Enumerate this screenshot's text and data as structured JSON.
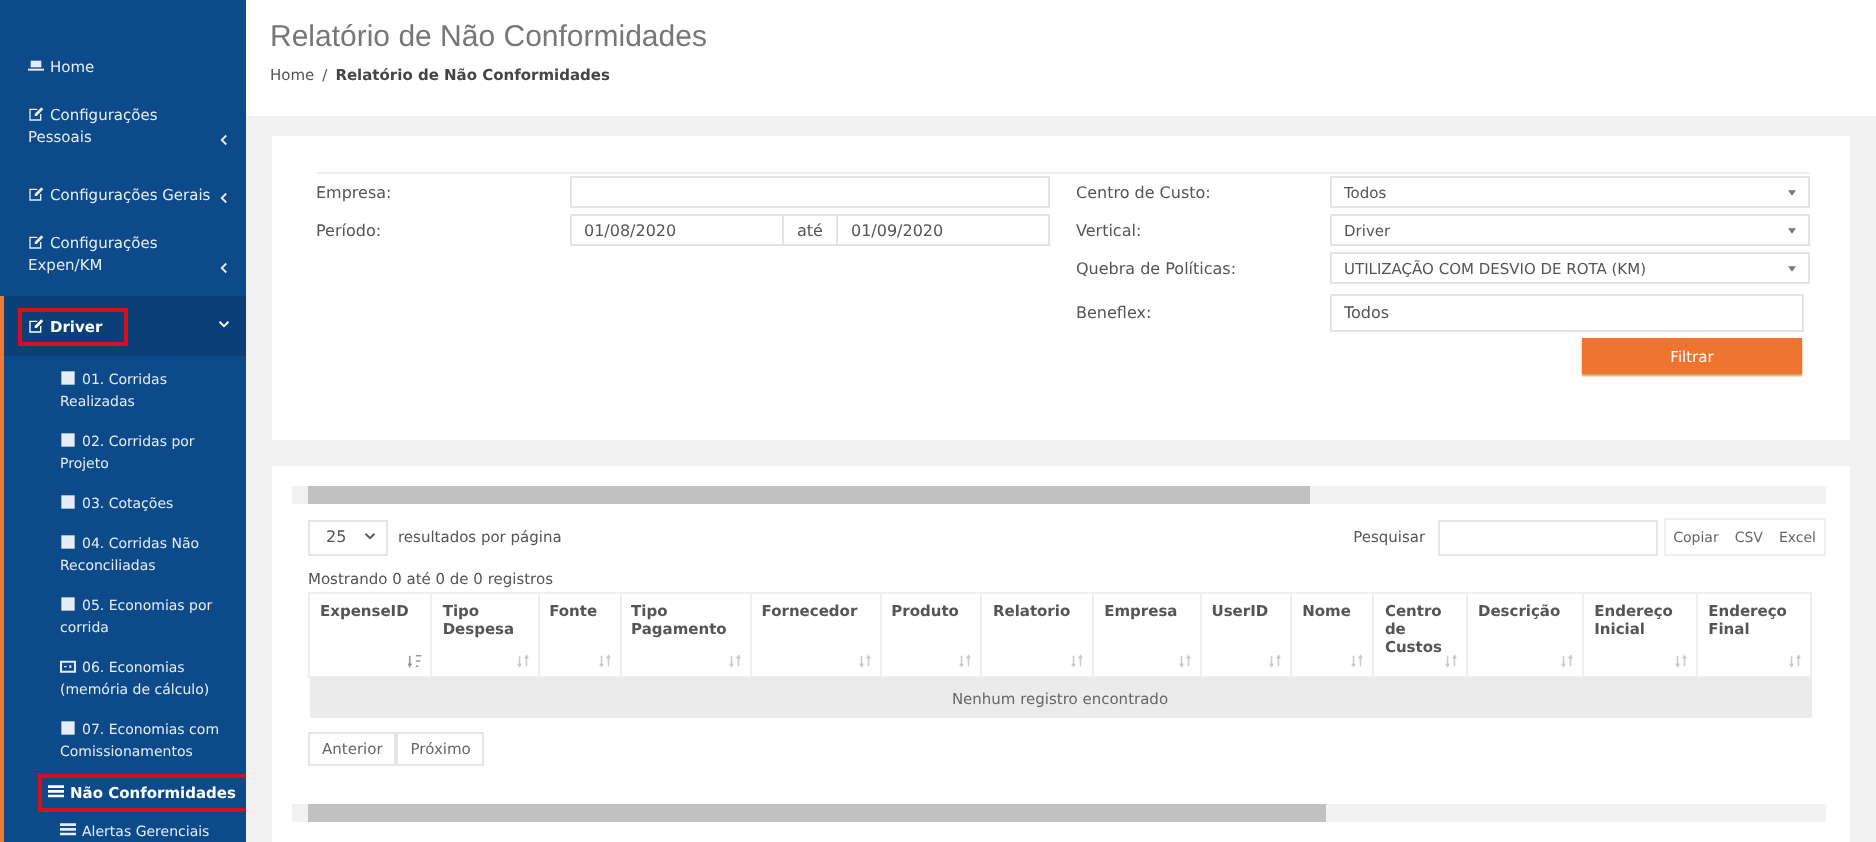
{
  "sidebar": {
    "items": [
      {
        "label": "Home",
        "kind": "home",
        "expanded": false,
        "highlighted": false
      },
      {
        "label": "Configurações Pessoais",
        "kind": "section",
        "expanded": false,
        "highlighted": false,
        "has_caret": true
      },
      {
        "label": "Configurações Gerais",
        "kind": "section",
        "expanded": false,
        "highlighted": false,
        "has_caret": true
      },
      {
        "label": "Configurações Expen/KM",
        "kind": "section",
        "expanded": false,
        "highlighted": false,
        "has_caret": true
      },
      {
        "label": "Driver",
        "kind": "section",
        "expanded": true,
        "highlighted": true,
        "has_caret": true,
        "children": [
          {
            "label": "01. Corridas Realizadas",
            "kind": "page",
            "selected": false,
            "highlighted": false
          },
          {
            "label": "02. Corridas por Projeto",
            "kind": "page",
            "selected": false,
            "highlighted": false
          },
          {
            "label": "03. Cotações",
            "kind": "page",
            "selected": false,
            "highlighted": false
          },
          {
            "label": "04. Corridas Não Reconciliadas",
            "kind": "page",
            "selected": false,
            "highlighted": false
          },
          {
            "label": "05. Economias por corrida",
            "kind": "page",
            "selected": false,
            "highlighted": false
          },
          {
            "label": "06. Economias (memória de cálculo)",
            "kind": "calculation",
            "selected": false,
            "highlighted": false
          },
          {
            "label": "07. Economias com Comissionamentos",
            "kind": "page",
            "selected": false,
            "highlighted": false
          },
          {
            "label": "Não Conformidades",
            "kind": "list",
            "selected": true,
            "highlighted": true
          },
          {
            "label": "Alertas Gerenciais",
            "kind": "list",
            "selected": false,
            "highlighted": false
          }
        ]
      }
    ]
  },
  "header": {
    "title": "Relatório de Não Conformidades",
    "breadcrumb": [
      "Home",
      "/",
      "Relatório de Não Conformidades"
    ]
  },
  "filters": {
    "empresa": {
      "label": "Empresa:"
    },
    "periodo": {
      "label": "Período:",
      "start": "01/08/2020",
      "separator": "até",
      "end": "01/09/2020"
    },
    "selects": [
      {
        "label": "Centro de Custo:",
        "value": "Todos",
        "kind": "select"
      },
      {
        "label": "Vertical:",
        "value": "Driver",
        "kind": "select"
      },
      {
        "label": "Quebra de Políticas:",
        "value": "UTILIZAÇÃO COM DESVIO DE ROTA (KM)",
        "kind": "select"
      },
      {
        "label": "Beneflex:",
        "value": "Todos",
        "kind": "input"
      }
    ],
    "button": "Filtrar"
  },
  "table": {
    "page_size": "25",
    "page_size_label": "resultados por página",
    "search_label": "Pesquisar",
    "export_buttons": [
      "Copiar",
      "CSV",
      "Excel"
    ],
    "info": "Mostrando 0 até 0 de 0 registros",
    "columns": [
      {
        "label": "ExpenseID",
        "sorted": true
      },
      {
        "label": "Tipo Despesa",
        "sorted": false
      },
      {
        "label": "Fonte",
        "sorted": false
      },
      {
        "label": "Tipo Pagamento",
        "sorted": false
      },
      {
        "label": "Fornecedor",
        "sorted": false
      },
      {
        "label": "Produto",
        "sorted": false
      },
      {
        "label": "Relatorio",
        "sorted": false
      },
      {
        "label": "Empresa",
        "sorted": false
      },
      {
        "label": "UserID",
        "sorted": false
      },
      {
        "label": "Nome",
        "sorted": false
      },
      {
        "label": "Centro de Custos",
        "sorted": false
      },
      {
        "label": "Descrição",
        "sorted": false
      },
      {
        "label": "Endereço Inicial",
        "sorted": false
      },
      {
        "label": "Endereço Final",
        "sorted": false
      }
    ],
    "empty_message": "Nenhum registro encontrado",
    "pagination": [
      "Anterior",
      "Próximo"
    ]
  }
}
